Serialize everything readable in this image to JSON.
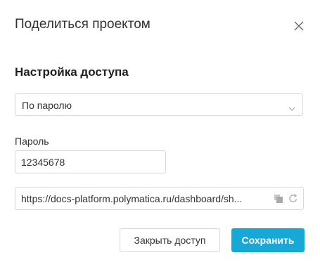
{
  "dialog": {
    "title": "Поделиться проектом",
    "close_icon": "close-icon"
  },
  "access": {
    "section_title": "Настройка доступа",
    "mode_selected": "По паролю",
    "password_label": "Пароль",
    "password_value": "12345678",
    "link_value": "https://docs-platform.polymatica.ru/dashboard/sh...",
    "copy_icon": "copy-icon",
    "refresh_icon": "refresh-icon"
  },
  "buttons": {
    "close_access": "Закрыть доступ",
    "save": "Сохранить"
  },
  "colors": {
    "accent": "#16a9d8",
    "border": "#d9d9d9"
  }
}
